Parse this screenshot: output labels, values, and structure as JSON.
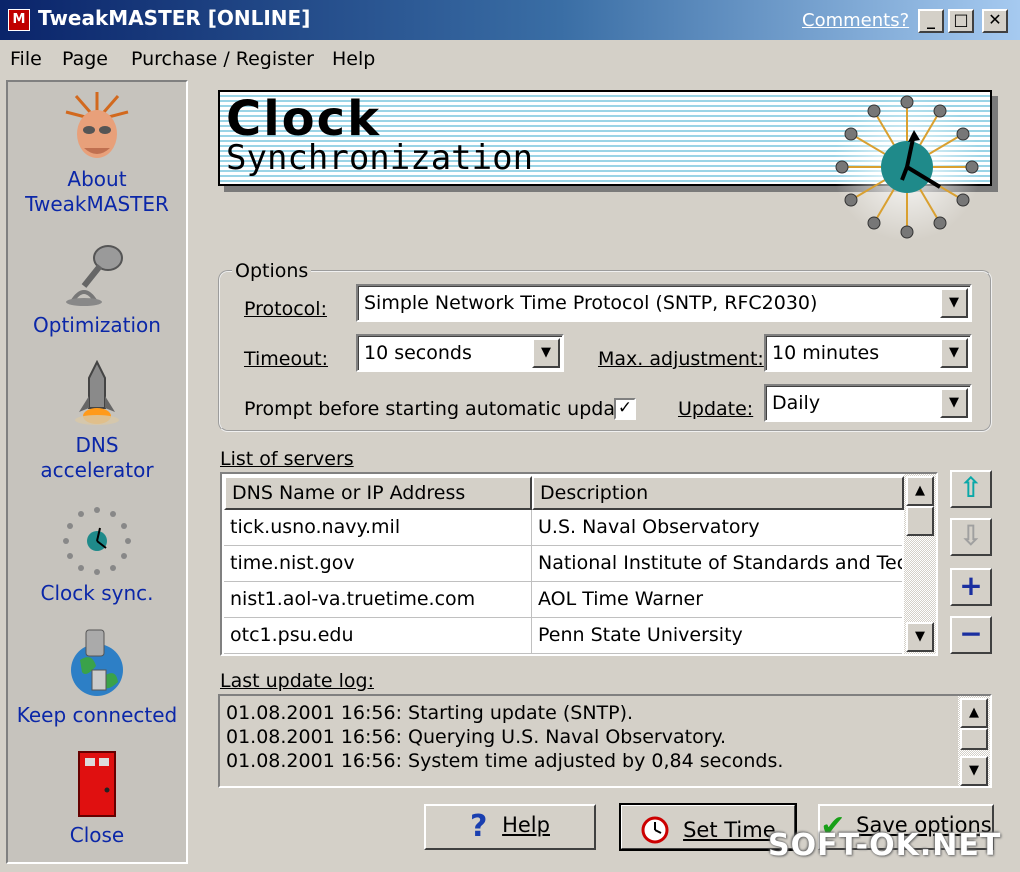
{
  "window": {
    "app_icon": "M",
    "title": "TweakMASTER [ONLINE]",
    "comments_link": "Comments?",
    "minimize": "_",
    "maximize": "□",
    "close": "✕"
  },
  "menu": [
    "File",
    "Page",
    "Purchase / Register",
    "Help"
  ],
  "sidebar": [
    {
      "label": "About TweakMASTER",
      "icon": "wizard-head-icon"
    },
    {
      "label": "Optimization",
      "icon": "microphone-icon"
    },
    {
      "label": "DNS accelerator",
      "icon": "rocket-icon"
    },
    {
      "label": "Clock sync.",
      "icon": "clock-icon"
    },
    {
      "label": "Keep connected",
      "icon": "globe-plug-icon"
    },
    {
      "label": "Close",
      "icon": "door-icon"
    }
  ],
  "banner": {
    "title": "Clock",
    "subtitle": "Synchronization"
  },
  "options": {
    "legend": "Options",
    "protocol_label": "Protocol:",
    "protocol_value": "Simple Network Time Protocol (SNTP, RFC2030)",
    "timeout_label": "Timeout:",
    "timeout_value": "10 seconds",
    "max_adj_label": "Max. adjustment:",
    "max_adj_value": "10 minutes",
    "prompt_label": "Prompt before starting automatic update",
    "prompt_checked": true,
    "update_label": "Update:",
    "update_value": "Daily"
  },
  "servers": {
    "label": "List of servers",
    "columns": [
      "DNS Name or IP Address",
      "Description"
    ],
    "rows": [
      [
        "tick.usno.navy.mil",
        "U.S. Naval Observatory"
      ],
      [
        "time.nist.gov",
        "National Institute of Standards and Tech"
      ],
      [
        "nist1.aol-va.truetime.com",
        "AOL Time Warner"
      ],
      [
        "otc1.psu.edu",
        "Penn State University"
      ]
    ]
  },
  "log": {
    "label": "Last update log:",
    "lines": [
      "01.08.2001 16:56: Starting update (SNTP).",
      "01.08.2001 16:56: Querying U.S. Naval Observatory.",
      "01.08.2001 16:56: System time adjusted by 0,84 seconds."
    ]
  },
  "buttons": {
    "help": "Help",
    "set_time": "Set Time",
    "save_options": "Save options"
  },
  "watermark": "SOFT-OK.NET",
  "colors": {
    "titlebar_start": "#0a246a",
    "titlebar_end": "#a6caf0",
    "face": "#d4d0c8",
    "nav_link": "#0b27a8",
    "banner_stripe": "#9ad4e6",
    "clock_face": "#1f8a8a"
  }
}
